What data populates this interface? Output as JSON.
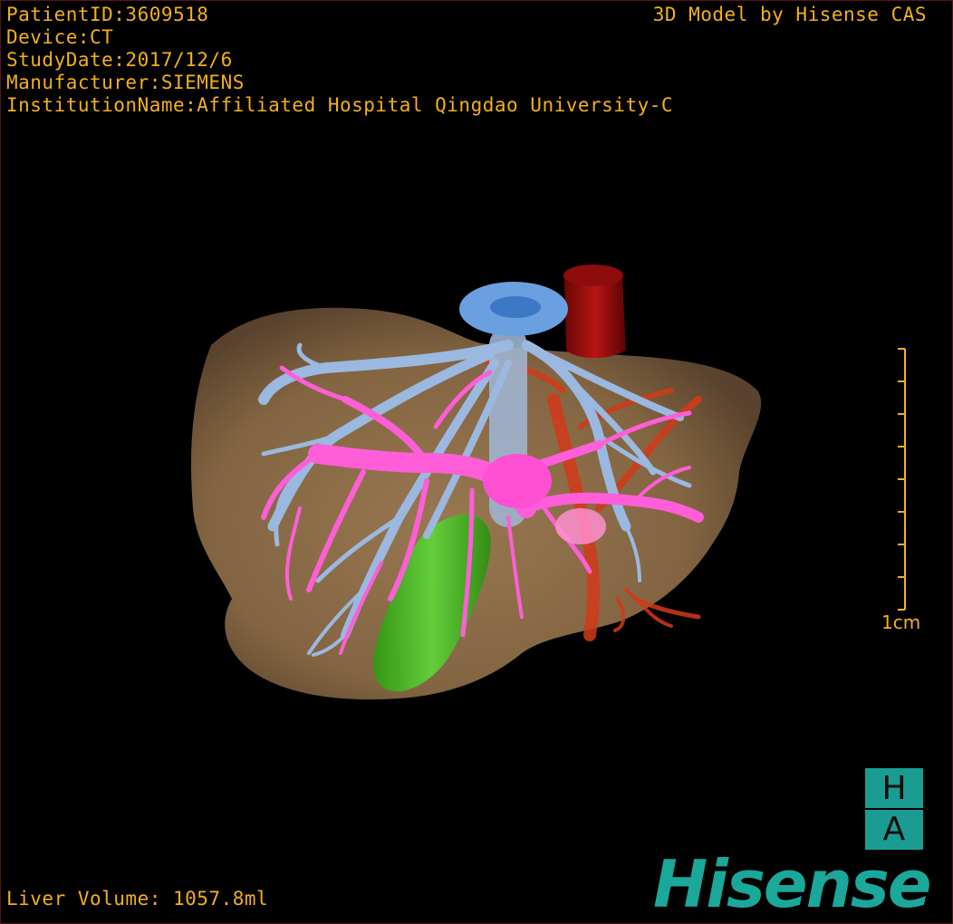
{
  "overlay": {
    "info_lines": [
      "PatientID:3609518",
      "Device:CT",
      "StudyDate:2017/12/6",
      "Manufacturer:SIEMENS",
      "InstitutionName:Affiliated Hospital Qingdao University-C"
    ],
    "credit": "3D Model by Hisense CAS",
    "liver_volume": "Liver Volume: 1057.8ml"
  },
  "scale_bar": {
    "label": "1cm",
    "tick_count": 9
  },
  "logo": {
    "badge_top": "H",
    "badge_bottom": "A",
    "brand": "Hisense"
  },
  "colors": {
    "overlay_text": "#f2b01e",
    "liver": "#8a6a45",
    "hepatic_vein": "#9bb8e0",
    "portal_vein": "#ff5ed8",
    "artery": "#d23a1a",
    "ivc": "#8b0a0a",
    "gallbladder": "#3fbf22",
    "brand": "#1ba79a"
  }
}
